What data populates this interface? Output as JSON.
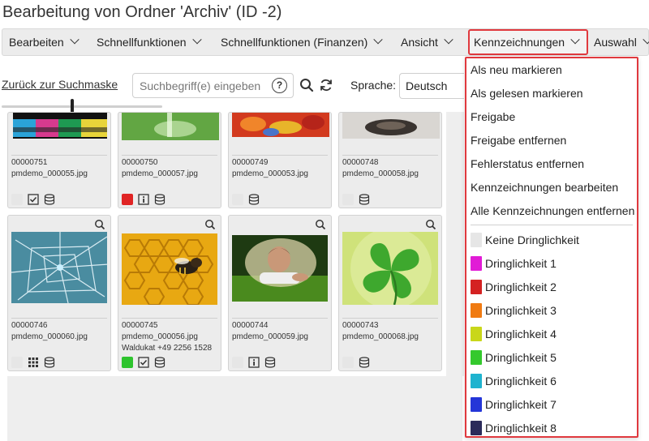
{
  "window": {
    "title": "Bearbeitung von Ordner 'Archiv' (ID -2)"
  },
  "menubar": {
    "items": [
      {
        "label": "Bearbeiten"
      },
      {
        "label": "Schnellfunktionen"
      },
      {
        "label": "Schnellfunktionen (Finanzen)"
      },
      {
        "label": "Ansicht"
      },
      {
        "label": "Kennzeichnungen",
        "active": true
      },
      {
        "label": "Auswahl"
      }
    ]
  },
  "toolbar": {
    "back_link": "Zurück zur Suchmaske",
    "search_placeholder": "Suchbegriff(e) eingeben",
    "search_value": "",
    "language_label": "Sprache:",
    "language_value": "Deutsch",
    "slider_level": 0.44
  },
  "tiles": [
    {
      "id": "00000751",
      "file": "pmdemo_000055.jpg",
      "extra": "",
      "status_color": "#e6e6e6",
      "icons": [
        "check-icon",
        "database-icon"
      ]
    },
    {
      "id": "00000750",
      "file": "pmdemo_000057.jpg",
      "extra": "",
      "status_color": "#e02424",
      "icons": [
        "info-icon",
        "database-icon"
      ]
    },
    {
      "id": "00000749",
      "file": "pmdemo_000053.jpg",
      "extra": "",
      "status_color": "",
      "icons": [
        "database-icon"
      ]
    },
    {
      "id": "00000748",
      "file": "pmdemo_000058.jpg",
      "extra": "",
      "status_color": "#e6e6e6",
      "icons": [
        "database-icon"
      ]
    },
    {
      "id": "00000746",
      "file": "pmdemo_000060.jpg",
      "extra": "",
      "status_color": "#e6e6e6",
      "icons": [
        "grid-icon",
        "database-icon"
      ]
    },
    {
      "id": "00000745",
      "file": "pmdemo_000056.jpg",
      "extra": "Waldukat +49 2256 1528",
      "status_color": "#2ec42e",
      "icons": [
        "check-icon",
        "database-icon"
      ]
    },
    {
      "id": "00000744",
      "file": "pmdemo_000059.jpg",
      "extra": "",
      "status_color": "#e6e6e6",
      "icons": [
        "info-icon",
        "database-icon"
      ]
    },
    {
      "id": "00000743",
      "file": "pmdemo_000068.jpg",
      "extra": "",
      "status_color": "#e6e6e6",
      "icons": [
        "database-icon"
      ]
    }
  ],
  "dropdown": {
    "items": [
      "Als neu markieren",
      "Als gelesen markieren",
      "Freigabe",
      "Freigabe entfernen",
      "Fehlerstatus entfernen",
      "Kennzeichnungen bearbeiten",
      "Alle Kennzeichnungen entfernen"
    ],
    "priorities": [
      {
        "label": "Keine Dringlichkeit",
        "color": "#e6e6e6"
      },
      {
        "label": "Dringlichkeit 1",
        "color": "#e11bd6"
      },
      {
        "label": "Dringlichkeit 2",
        "color": "#d42222"
      },
      {
        "label": "Dringlichkeit 3",
        "color": "#f07b12"
      },
      {
        "label": "Dringlichkeit 4",
        "color": "#c9d71a"
      },
      {
        "label": "Dringlichkeit 5",
        "color": "#34c92d"
      },
      {
        "label": "Dringlichkeit 6",
        "color": "#1fb3cf"
      },
      {
        "label": "Dringlichkeit 7",
        "color": "#2436d8"
      },
      {
        "label": "Dringlichkeit 8",
        "color": "#2b2b5a"
      }
    ]
  },
  "colors": {
    "highlight_border": "#e0393e",
    "menubar_bg": "#ececec"
  }
}
